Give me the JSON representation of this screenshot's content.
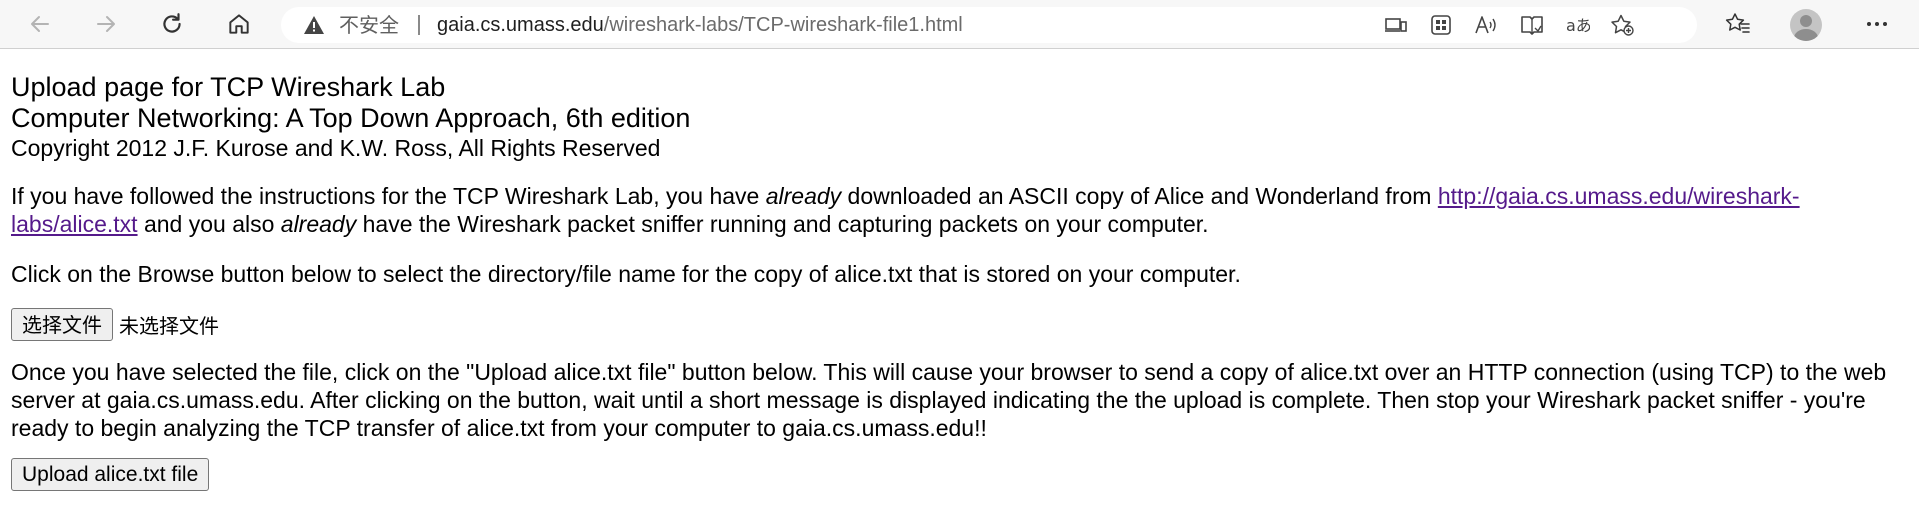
{
  "browser": {
    "address": {
      "security_label": "不安全",
      "host": "gaia.cs.umass.edu",
      "path": "/wireshark-labs/TCP-wireshark-file1.html"
    },
    "icons": {
      "back": "back-arrow-icon",
      "forward": "forward-arrow-icon",
      "refresh": "refresh-icon",
      "home": "home-icon",
      "warning": "warning-icon",
      "cast": "cast-device-icon",
      "apps": "apps-icon",
      "read_aloud": "read-aloud-icon",
      "immersive_reader": "immersive-reader-icon",
      "translate": "translate-icon",
      "favorite_add": "favorite-add-icon",
      "favorites": "favorites-icon",
      "profile": "profile-icon",
      "menu": "more-menu-icon"
    }
  },
  "page": {
    "heading1": "Upload page for TCP Wireshark Lab",
    "heading2": "Computer Networking: A Top Down Approach, 6th edition",
    "heading3": "Copyright 2012 J.F. Kurose and K.W. Ross, All Rights Reserved",
    "para1": {
      "text1": "If you have followed the instructions for the TCP Wireshark Lab, you have ",
      "em1": "already",
      "text2": " downloaded an ASCII copy of Alice and Wonderland from ",
      "link": "http://gaia.cs.umass.edu/wireshark-labs/alice.txt",
      "text3": " and you also ",
      "em2": "already",
      "text4": " have the Wireshark packet sniffer running and capturing packets on your computer."
    },
    "para2": "Click on the Browse button below to select the directory/file name for the copy of alice.txt that is stored on your computer.",
    "file_input": {
      "button_label": "选择文件",
      "status": "未选择文件"
    },
    "para3": "Once you have selected the file, click on the \"Upload alice.txt file\" button below. This will cause your browser to send a copy of alice.txt over an HTTP connection (using TCP) to the web server at gaia.cs.umass.edu. After clicking on the button, wait until a short message is displayed indicating the the upload is complete. Then stop your Wireshark packet sniffer - you're ready to begin analyzing the TCP transfer of alice.txt from your computer to gaia.cs.umass.edu!!",
    "upload_button": "Upload alice.txt file"
  }
}
